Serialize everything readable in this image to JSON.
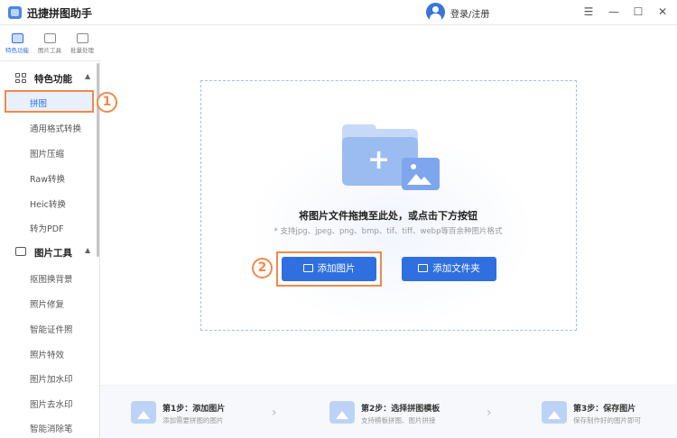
{
  "app": {
    "title": "迅捷拼图助手",
    "login": "登录/注册"
  },
  "window": {
    "menu": "☰",
    "minimize": "—",
    "maximize": "☐",
    "close": "✕"
  },
  "topnav": [
    {
      "label": "特色功能",
      "active": true
    },
    {
      "label": "图片工具",
      "active": false
    },
    {
      "label": "批量处理",
      "active": false
    }
  ],
  "sidebar": {
    "section1": {
      "title": "特色功能",
      "chevron": "▲"
    },
    "active_item": "拼图",
    "items1": [
      "通用格式转换",
      "图片压缩",
      "Raw转换",
      "Heic转换",
      "转为PDF"
    ],
    "section2": {
      "title": "图片工具",
      "chevron": "▲"
    },
    "items2": [
      "抠图换背景",
      "照片修复",
      "智能证件照",
      "照片特效",
      "图片加水印",
      "图片去水印",
      "智能消除笔"
    ]
  },
  "annotations": {
    "one": "1",
    "two": "2"
  },
  "dropzone": {
    "title": "将图片文件拖拽至此处，或点击下方按钮",
    "hint": "* 支持jpg、jpeg、png、bmp、tif、tiff、webp等百余种图片格式",
    "add_image": "添加图片",
    "add_folder": "添加文件夹"
  },
  "steps": [
    {
      "title": "第1步：添加图片",
      "desc": "添加需要拼图的图片"
    },
    {
      "title": "第2步：选择拼图模板",
      "desc": "支持模板拼图、图片拼接"
    },
    {
      "title": "第3步：保存图片",
      "desc": "保存制作好的图片即可"
    }
  ],
  "colors": {
    "accent": "#2f6fe0",
    "highlight": "#f08a4b"
  }
}
